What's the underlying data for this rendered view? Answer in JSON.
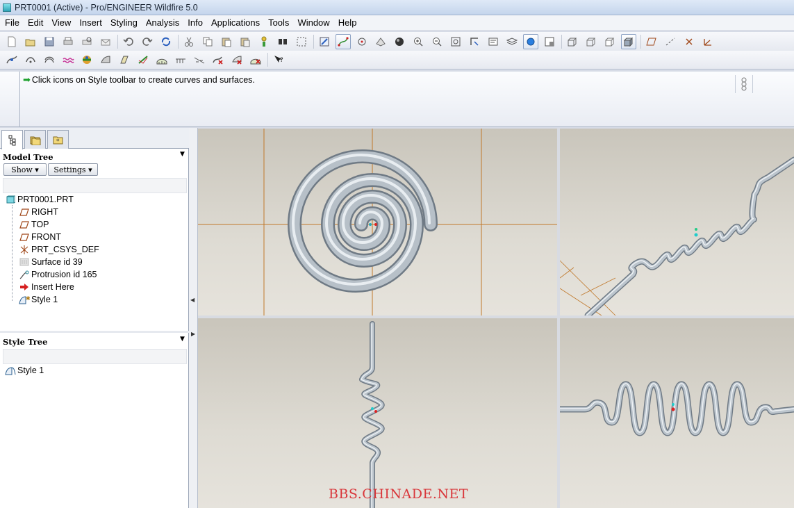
{
  "window": {
    "title": "PRT0001 (Active) - Pro/ENGINEER Wildfire 5.0"
  },
  "menubar": [
    {
      "label": "File",
      "name": "menu-file"
    },
    {
      "label": "Edit",
      "name": "menu-edit"
    },
    {
      "label": "View",
      "name": "menu-view"
    },
    {
      "label": "Insert",
      "name": "menu-insert"
    },
    {
      "label": "Styling",
      "name": "menu-styling"
    },
    {
      "label": "Analysis",
      "name": "menu-analysis"
    },
    {
      "label": "Info",
      "name": "menu-info"
    },
    {
      "label": "Applications",
      "name": "menu-applications"
    },
    {
      "label": "Tools",
      "name": "menu-tools"
    },
    {
      "label": "Window",
      "name": "menu-window"
    },
    {
      "label": "Help",
      "name": "menu-help"
    }
  ],
  "message": {
    "text": "Click icons on Style toolbar to create curves and surfaces."
  },
  "navigator": {
    "model_tree": {
      "header": "Model Tree",
      "show_label": "Show ▾",
      "settings_label": "Settings ▾",
      "items": [
        {
          "label": "PRT0001.PRT",
          "icon": "part-icon"
        },
        {
          "label": "RIGHT",
          "icon": "datum-plane-icon"
        },
        {
          "label": "TOP",
          "icon": "datum-plane-icon"
        },
        {
          "label": "FRONT",
          "icon": "datum-plane-icon"
        },
        {
          "label": "PRT_CSYS_DEF",
          "icon": "coordinate-system-icon"
        },
        {
          "label": "Surface id 39",
          "icon": "surface-icon"
        },
        {
          "label": "Protrusion id 165",
          "icon": "protrusion-icon"
        },
        {
          "label": "Insert Here",
          "icon": "insert-arrow-icon"
        },
        {
          "label": "Style 1",
          "icon": "style-feature-icon"
        }
      ]
    },
    "style_tree": {
      "header": "Style Tree",
      "items": [
        {
          "label": "Style 1",
          "icon": "style-feature-icon"
        }
      ]
    }
  },
  "watermark": "BBS.CHINADE.NET",
  "colors": {
    "model_surface": "#b7c0c8",
    "datum_line": "#c0782a",
    "message_arrow": "#1aa02a",
    "watermark": "#d9363a"
  }
}
